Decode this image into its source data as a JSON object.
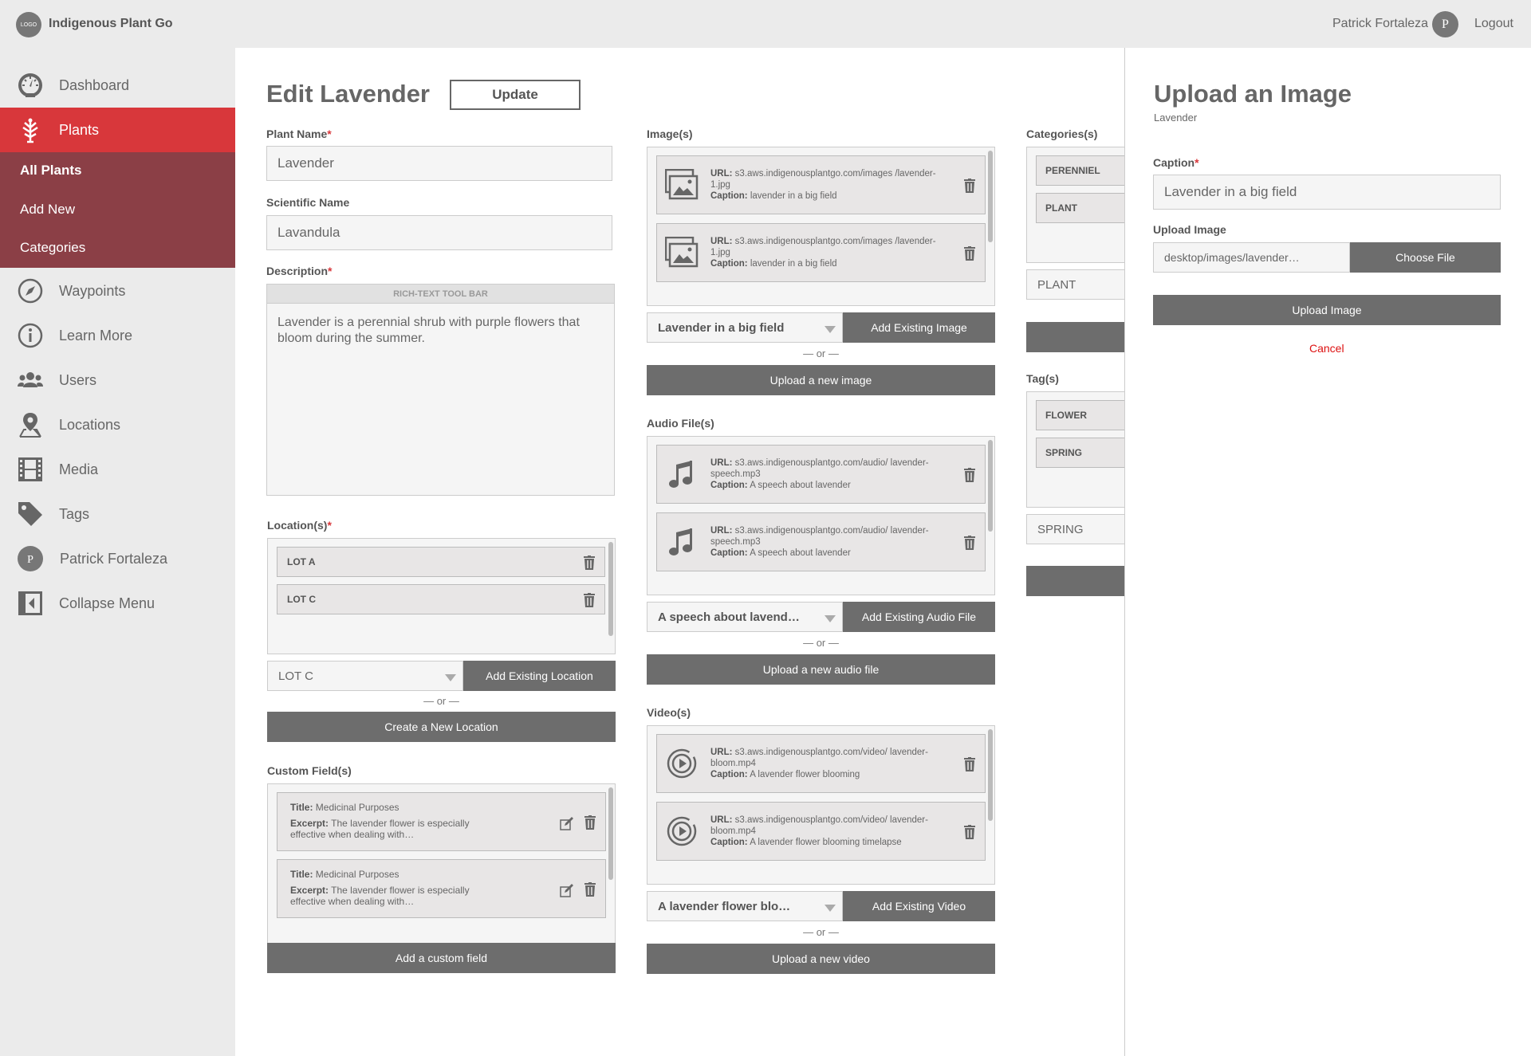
{
  "app": {
    "logo": "LOGO",
    "title": "Indigenous Plant Go"
  },
  "header": {
    "user_name": "Patrick Fortaleza",
    "avatar_initial": "P",
    "logout": "Logout"
  },
  "sidebar": {
    "items": [
      {
        "label": "Dashboard",
        "icon": "dashboard-icon"
      },
      {
        "label": "Plants",
        "icon": "plant-icon",
        "active": true
      },
      {
        "label": "Waypoints",
        "icon": "compass-icon"
      },
      {
        "label": "Learn More",
        "icon": "info-icon"
      },
      {
        "label": "Users",
        "icon": "users-icon"
      },
      {
        "label": "Locations",
        "icon": "location-icon"
      },
      {
        "label": "Media",
        "icon": "film-icon"
      },
      {
        "label": "Tags",
        "icon": "tag-icon"
      },
      {
        "label": "Patrick Fortaleza",
        "icon": "avatar-icon"
      },
      {
        "label": "Collapse Menu",
        "icon": "collapse-icon"
      }
    ],
    "subitems": [
      "All Plants",
      "Add New",
      "Categories"
    ]
  },
  "page": {
    "title": "Edit Lavender",
    "update": "Update"
  },
  "form": {
    "plant_name_label": "Plant Name",
    "plant_name": "Lavender",
    "sci_name_label": "Scientific Name",
    "sci_name": "Lavandula",
    "desc_label": "Description",
    "toolbar": "RICH-TEXT TOOL BAR",
    "description": "Lavender is a perennial shrub with purple flowers that bloom during the summer.",
    "locations_label": "Location(s)",
    "locations": [
      "LOT A",
      "LOT C"
    ],
    "location_select": "LOT C",
    "add_location": "Add Existing Location",
    "or": "— or —",
    "create_location": "Create a New Location",
    "custom_label": "Custom Field(s)",
    "custom_fields": [
      {
        "title_k": "Title:",
        "title": "Medicinal Purposes",
        "excerpt_k": "Excerpt:",
        "excerpt": "The lavender flower is especially effective when dealing with…"
      },
      {
        "title_k": "Title:",
        "title": "Medicinal Purposes",
        "excerpt_k": "Excerpt:",
        "excerpt": "The lavender flower is especially effective when dealing with…"
      }
    ],
    "add_custom": "Add a custom field"
  },
  "media": {
    "url_k": "URL:",
    "caption_k": "Caption:",
    "images_label": "Image(s)",
    "images": [
      {
        "url": "s3.aws.indigenousplantgo.com/images /lavender-1.jpg",
        "caption": "lavender in a big field"
      },
      {
        "url": "s3.aws.indigenousplantgo.com/images /lavender-1.jpg",
        "caption": "lavender in a big field"
      }
    ],
    "image_select": "Lavender in a big field",
    "add_image": "Add Existing Image",
    "upload_image": "Upload a new image",
    "audio_label": "Audio File(s)",
    "audio": [
      {
        "url": "s3.aws.indigenousplantgo.com/audio/ lavender-speech.mp3",
        "caption": "A speech about lavender"
      },
      {
        "url": "s3.aws.indigenousplantgo.com/audio/ lavender-speech.mp3",
        "caption": "A speech about lavender"
      }
    ],
    "audio_select": "A speech about lavend…",
    "add_audio": "Add Existing Audio File",
    "upload_audio": "Upload a new audio file",
    "video_label": "Video(s)",
    "video": [
      {
        "url": "s3.aws.indigenousplantgo.com/video/ lavender-bloom.mp4",
        "caption": "A lavender flower blooming"
      },
      {
        "url": "s3.aws.indigenousplantgo.com/video/ lavender-bloom.mp4",
        "caption": "A lavender flower blooming timelapse"
      }
    ],
    "video_select": "A lavender flower blo…",
    "add_video": "Add Existing Video",
    "upload_video": "Upload a new video"
  },
  "taxonomy": {
    "categories_label": "Categories(s)",
    "categories": [
      "PERENNIEL",
      "PLANT"
    ],
    "category_select": "PLANT",
    "tags_label": "Tag(s)",
    "tags": [
      "FLOWER",
      "SPRING"
    ],
    "tag_select": "SPRING"
  },
  "panel": {
    "title": "Upload an Image",
    "subtitle": "Lavender",
    "caption_label": "Caption",
    "caption": "Lavender in a big field",
    "upload_label": "Upload Image",
    "file_path": "desktop/images/lavender…",
    "choose_file": "Choose File",
    "upload_button": "Upload Image",
    "cancel": "Cancel"
  },
  "colors": {
    "accent": "#d8373b",
    "submenu": "#8b3f46",
    "button": "#6d6d6d"
  }
}
